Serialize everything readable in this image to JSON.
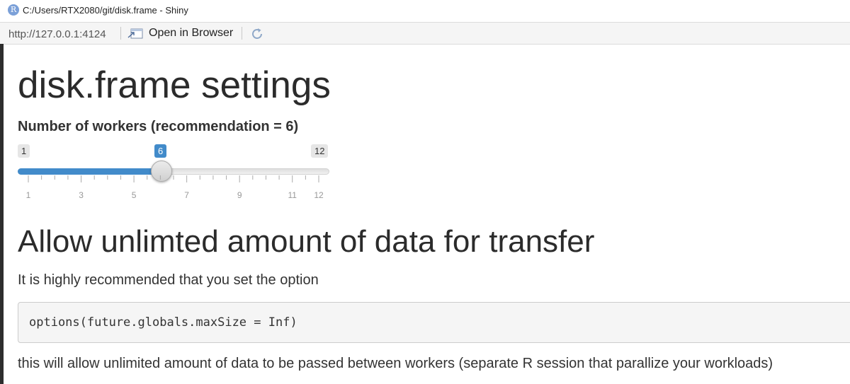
{
  "window": {
    "title": "C:/Users/RTX2080/git/disk.frame - Shiny",
    "logo_letter": "R"
  },
  "toolbar": {
    "url": "http://127.0.0.1:4124",
    "open_in_browser_label": "Open in Browser",
    "open_icon": "open-window-icon",
    "refresh_icon": "refresh-icon"
  },
  "page": {
    "title": "disk.frame settings",
    "slider": {
      "label": "Number of workers (recommendation = 6)",
      "min": 1,
      "max": 12,
      "value": 6,
      "min_label": "1",
      "max_label": "12",
      "value_label": "6",
      "accent_color": "#428bca",
      "tick_labels": [
        "1",
        "3",
        "5",
        "7",
        "9",
        "11",
        "12"
      ]
    },
    "section_title": "Allow unlimted amount of data for transfer",
    "intro_text": "It is highly recommended that you set the option",
    "code": "options(future.globals.maxSize = Inf)",
    "note_text": "this will allow unlimited amount of data to be passed between workers (separate R session that parallize your workloads)"
  }
}
